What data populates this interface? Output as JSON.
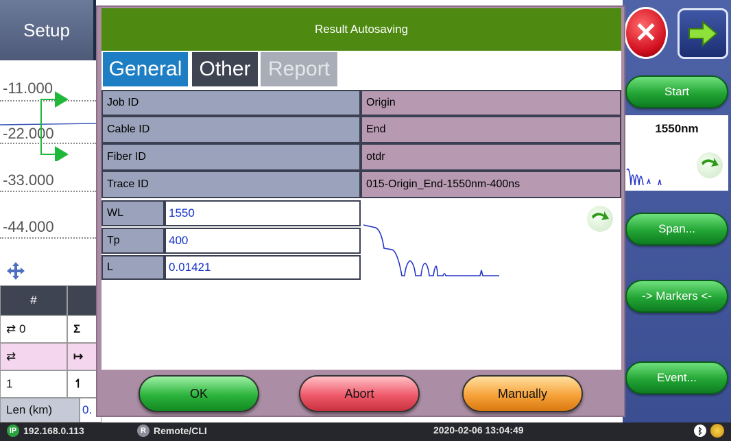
{
  "background": {
    "setup_label": "Setup",
    "y_ticks": [
      "-11.000",
      "-22.000",
      "-33.000",
      "-44.000"
    ],
    "table_header": "#",
    "table_rows": [
      {
        "col1": "⇄ 0",
        "col2": "Σ"
      },
      {
        "col1": "⇄",
        "col2": "↦"
      },
      {
        "col1": "1",
        "col2": "↿"
      }
    ],
    "len_label": "Len (km)",
    "len_value": "0."
  },
  "right_panel": {
    "start_label": "Start",
    "wavelength": "1550nm",
    "span_label": "Span...",
    "markers_label": "-> Markers <-",
    "event_label": "Event..."
  },
  "status_bar": {
    "ip_badge": "IP",
    "ip": "192.168.0.113",
    "remote_badge": "R",
    "remote": "Remote/CLI",
    "datetime": "2020-02-06 13:04:49"
  },
  "dialog": {
    "title": "Result Autosaving",
    "tabs": [
      {
        "label": "General",
        "state": "active"
      },
      {
        "label": "Other",
        "state": "normal"
      },
      {
        "label": "Report",
        "state": "disabled"
      }
    ],
    "fields": [
      {
        "label": "Job ID",
        "value": "Origin"
      },
      {
        "label": "Cable ID",
        "value": "End"
      },
      {
        "label": "Fiber ID",
        "value": "otdr"
      },
      {
        "label": "Trace ID",
        "value": "015-Origin_End-1550nm-400ns"
      }
    ],
    "params": [
      {
        "label": "WL",
        "value": "1550"
      },
      {
        "label": "Tp",
        "value": "400"
      },
      {
        "label": "L",
        "value": "0.01421"
      }
    ],
    "buttons": {
      "ok": "OK",
      "abort": "Abort",
      "manually": "Manually"
    }
  },
  "colors": {
    "title_bar": "#4e8a12",
    "tab_active": "#1d7ec4",
    "tab_other": "#3f4453",
    "tab_disabled": "#a9adb8",
    "ok": "#2bb33c",
    "abort": "#ef5a6a",
    "manually": "#f7a23a"
  }
}
